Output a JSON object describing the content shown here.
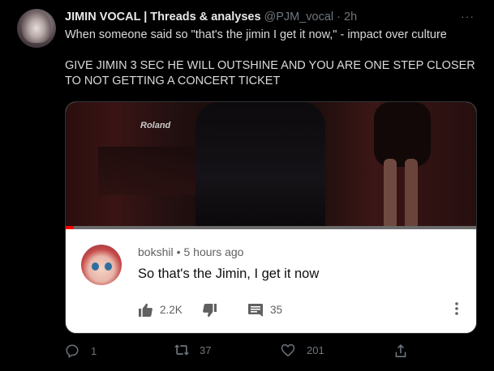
{
  "tweet": {
    "display_name": "JIMIN VOCAL | Threads & analyses",
    "handle": "@PJM_vocal",
    "separator": "·",
    "time": "2h",
    "more": "···",
    "text_line1": "When someone said so \"that's the jimin I get it now,\" - impact over culture",
    "text_line2": "GIVE JIMIN 3 SEC HE WILL OUTSHINE AND YOU ARE ONE STEP CLOSER TO NOT GETTING A CONCERT TICKET"
  },
  "media": {
    "video": {
      "sign_text": "Roland",
      "progress_fraction": 0.02,
      "progress_color": "#ff0000"
    },
    "comment": {
      "username": "bokshil",
      "separator": "•",
      "time": "5 hours ago",
      "text": "So that's the Jimin, I get it now",
      "likes": "2.2K",
      "replies": "35"
    }
  },
  "actions": {
    "replies": "1",
    "retweets": "37",
    "likes": "201"
  },
  "colors": {
    "background": "#000000",
    "muted": "#6e767d",
    "text": "#d9d9d9"
  },
  "icons": [
    "reply-icon",
    "retweet-icon",
    "like-icon",
    "share-icon",
    "thumbs-up-icon",
    "thumbs-down-icon",
    "comment-icon",
    "kebab-icon"
  ]
}
